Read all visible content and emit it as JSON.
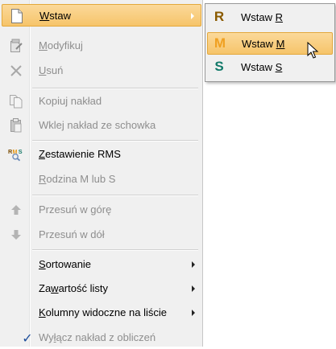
{
  "menu": {
    "items": [
      {
        "pre": "",
        "ul": "W",
        "post": "staw",
        "icon": "document-icon",
        "disabled": false,
        "submenu": true
      },
      {
        "pre": "",
        "ul": "M",
        "post": "odyfikuj",
        "icon": "edit-document-icon",
        "disabled": true
      },
      {
        "pre": "",
        "ul": "U",
        "post": "suń",
        "icon": "delete-x-icon",
        "disabled": true
      },
      {
        "label": "Kopiuj nakład",
        "icon": "copy-icon",
        "disabled": true
      },
      {
        "label": "Wklej nakład ze schowka",
        "icon": "paste-icon",
        "disabled": true
      },
      {
        "pre": "",
        "ul": "Z",
        "post": "estawienie RMS",
        "icon": "rms-icon",
        "disabled": false
      },
      {
        "pre": "",
        "ul": "R",
        "post": "odzina M lub S",
        "disabled": true
      },
      {
        "label": "Przesuń w górę",
        "icon": "arrow-up-icon",
        "disabled": true
      },
      {
        "label": "Przesuń w dół",
        "icon": "arrow-down-icon",
        "disabled": true
      },
      {
        "pre": "",
        "ul": "S",
        "post": "ortowanie",
        "disabled": false,
        "submenu": true
      },
      {
        "pre": "Za",
        "ul": "w",
        "post": "artość listy",
        "disabled": false,
        "submenu": true
      },
      {
        "pre": "",
        "ul": "K",
        "post": "olumny widoczne na liście",
        "disabled": false,
        "submenu": true
      },
      {
        "pre": "Wy",
        "ul": "ł",
        "post": "ącz nakład z obliczeń",
        "icon": "checkmark-icon",
        "disabled": true
      }
    ]
  },
  "submenu": {
    "items": [
      {
        "letter": "R",
        "letter_color": "#8a5a00",
        "pre": "Wstaw ",
        "ul": "R"
      },
      {
        "letter": "M",
        "letter_color": "#f0a020",
        "pre": "Wstaw ",
        "ul": "M"
      },
      {
        "letter": "S",
        "letter_color": "#127a6a",
        "pre": "Wstaw ",
        "ul": "S"
      }
    ]
  },
  "colors": {
    "highlight": "#f6c46a",
    "disabled_text": "#8e8e8e",
    "check": "#1e4e9b"
  }
}
